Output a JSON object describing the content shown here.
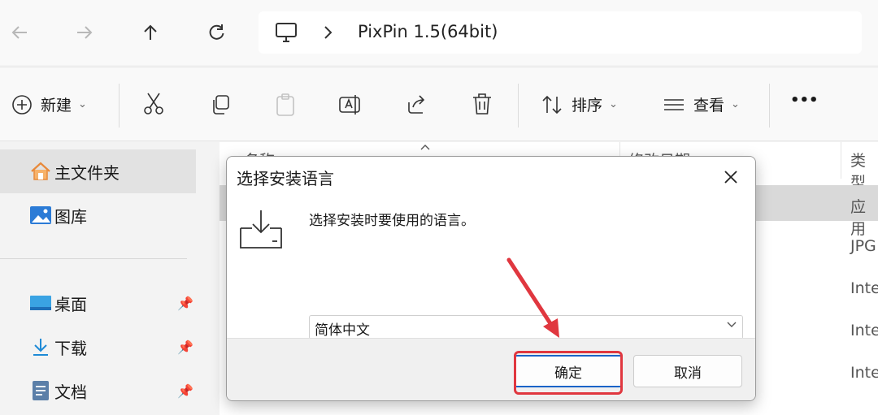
{
  "address": {
    "path": "PixPin 1.5(64bit)"
  },
  "toolbar": {
    "new_label": "新建",
    "sort_label": "排序",
    "view_label": "查看",
    "more_label": "•••"
  },
  "sidebar": {
    "items": [
      {
        "label": "主文件夹",
        "icon": "home-icon"
      },
      {
        "label": "图库",
        "icon": "gallery-icon"
      },
      {
        "label": "桌面",
        "icon": "desktop-icon"
      },
      {
        "label": "下载",
        "icon": "download-icon"
      },
      {
        "label": "文档",
        "icon": "documents-icon"
      }
    ]
  },
  "filelist": {
    "columns": [
      "名称",
      "修改日期",
      "类型"
    ],
    "types": [
      "应用",
      "JPG",
      "Inte",
      "Inte",
      "Inte"
    ]
  },
  "dialog": {
    "title": "选择安装语言",
    "message": "选择安装时要使用的语言。",
    "language": "简体中文",
    "ok_label": "确定",
    "cancel_label": "取消"
  },
  "colors": {
    "highlight_red": "#e0373f",
    "accent_blue": "#1a64c8"
  }
}
